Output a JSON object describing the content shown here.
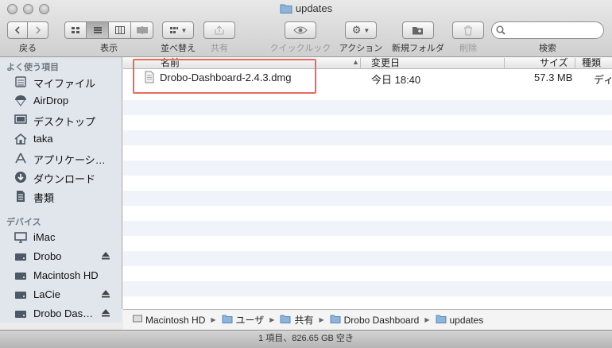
{
  "window": {
    "title": "updates"
  },
  "toolbar": {
    "back_label": "戻る",
    "view_label": "表示",
    "arrange_label": "並べ替え",
    "share_label": "共有",
    "quicklook_label": "クイックルック",
    "action_label": "アクション",
    "newfolder_label": "新規フォルダ",
    "delete_label": "削除",
    "search_label": "検索",
    "search_placeholder": ""
  },
  "sidebar": {
    "favorites_heading": "よく使う項目",
    "favorites": [
      {
        "label": "マイファイル",
        "icon": "all-my-files-icon"
      },
      {
        "label": "AirDrop",
        "icon": "airdrop-icon"
      },
      {
        "label": "デスクトップ",
        "icon": "desktop-icon"
      },
      {
        "label": "taka",
        "icon": "home-icon"
      },
      {
        "label": "アプリケーシ…",
        "icon": "applications-icon"
      },
      {
        "label": "ダウンロード",
        "icon": "downloads-icon"
      },
      {
        "label": "書類",
        "icon": "documents-icon"
      }
    ],
    "devices_heading": "デバイス",
    "devices": [
      {
        "label": "iMac",
        "icon": "computer-icon",
        "eject": false
      },
      {
        "label": "Drobo",
        "icon": "drive-icon",
        "eject": true
      },
      {
        "label": "Macintosh HD",
        "icon": "drive-icon",
        "eject": false
      },
      {
        "label": "LaCie",
        "icon": "drive-icon",
        "eject": true
      },
      {
        "label": "Drobo Das…",
        "icon": "disk-image-icon",
        "eject": true
      }
    ]
  },
  "list": {
    "columns": {
      "name": "名前",
      "modified": "変更日",
      "size": "サイズ",
      "kind": "種類"
    },
    "rows": [
      {
        "name": "Drobo-Dashboard-2.4.3.dmg",
        "modified": "今日 18:40",
        "size": "57.3 MB",
        "kind": "ディ"
      }
    ]
  },
  "pathbar": {
    "items": [
      "Macintosh HD",
      "ユーザ",
      "共有",
      "Drobo Dashboard",
      "updates"
    ]
  },
  "status": {
    "text": "1 項目、826.65 GB 空き"
  },
  "colors": {
    "highlight": "#e56b5d",
    "sidebar_bg": "#e1e6ed"
  }
}
